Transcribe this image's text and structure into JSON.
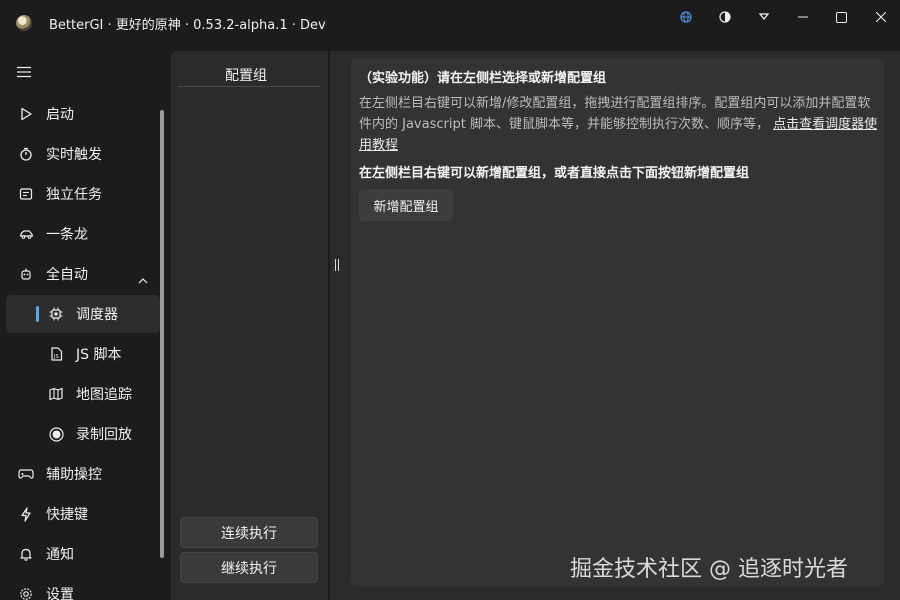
{
  "window": {
    "title": "BetterGI · 更好的原神 · 0.53.2-alpha.1 · Dev",
    "icons": [
      "globe-icon",
      "theme-icon",
      "dropdown-icon",
      "minimize-icon",
      "maximize-icon",
      "close-icon"
    ]
  },
  "colors": {
    "accent": "#5aa9e6",
    "background": "#1c1c1c",
    "panel": "#2b2b2b",
    "card": "#333333"
  },
  "sidebar": {
    "items": [
      {
        "label": "启动",
        "icon": "play-icon"
      },
      {
        "label": "实时触发",
        "icon": "stopwatch-icon"
      },
      {
        "label": "独立任务",
        "icon": "task-list-icon"
      },
      {
        "label": "一条龙",
        "icon": "car-icon"
      },
      {
        "label": "全自动",
        "icon": "robot-icon",
        "expanded": true
      },
      {
        "label": "调度器",
        "icon": "chip-icon",
        "sub": true,
        "selected": true
      },
      {
        "label": "JS 脚本",
        "icon": "js-file-icon",
        "sub": true
      },
      {
        "label": "地图追踪",
        "icon": "map-icon",
        "sub": true
      },
      {
        "label": "录制回放",
        "icon": "record-icon",
        "sub": true
      },
      {
        "label": "辅助操控",
        "icon": "gamepad-icon"
      },
      {
        "label": "快捷键",
        "icon": "flash-icon"
      },
      {
        "label": "通知",
        "icon": "bell-icon"
      },
      {
        "label": "设置",
        "icon": "settings-icon"
      }
    ]
  },
  "group_panel": {
    "header": "配置组",
    "buttons": {
      "continuous": "连续执行",
      "resume": "继续执行"
    }
  },
  "main": {
    "title": "（实验功能）请在左侧栏选择或新增配置组",
    "desc": "在左侧栏目右键可以新增/修改配置组，拖拽进行配置组排序。配置组内可以添加并配置软件内的 Javascript 脚本、键鼠脚本等，并能够控制执行次数、顺序等，",
    "link": "点击查看调度器使用教程",
    "hint": "在左侧栏目右键可以新增配置组，或者直接点击下面按钮新增配置组",
    "new_group_button": "新增配置组"
  },
  "watermark": "掘金技术社区 @ 追逐时光者"
}
